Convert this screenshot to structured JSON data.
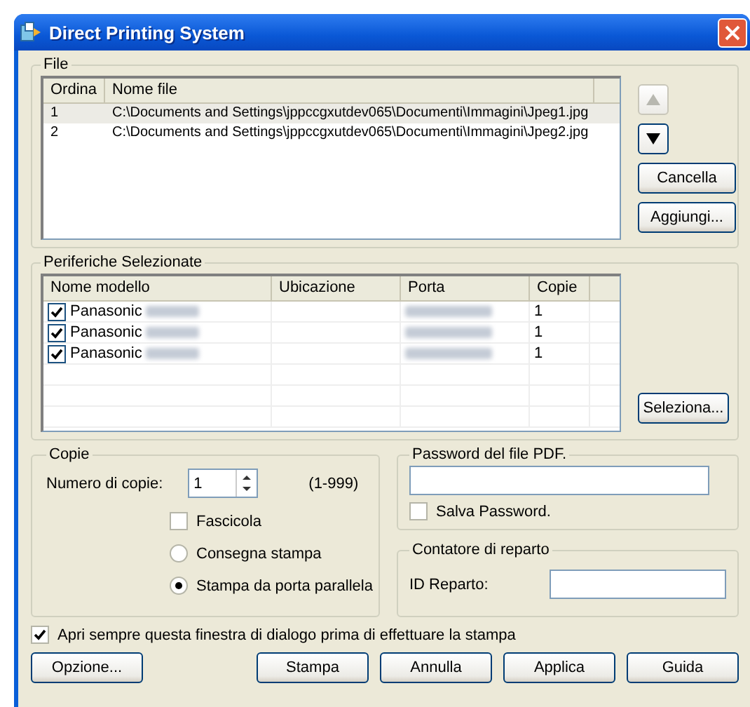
{
  "window": {
    "title": "Direct Printing System"
  },
  "file_group": {
    "label": "File",
    "columns": [
      "Ordina",
      "Nome file"
    ],
    "rows": [
      {
        "order": "1",
        "path": "C:\\Documents and Settings\\jppccgxutdev065\\Documenti\\Immagini\\Jpeg1.jpg",
        "selected": true
      },
      {
        "order": "2",
        "path": "C:\\Documents and Settings\\jppccgxutdev065\\Documenti\\Immagini\\Jpeg2.jpg",
        "selected": false
      }
    ],
    "move_up": {
      "disabled": true
    },
    "move_down": {
      "disabled": false
    },
    "buttons": [
      "Cancella",
      "Aggiungi..."
    ]
  },
  "devices": {
    "label": "Periferiche Selezionate",
    "columns": [
      "Nome modello",
      "Ubicazione",
      "Porta",
      "Copie"
    ],
    "rows": [
      {
        "name": "Panasonic",
        "checked": true,
        "copies": "1"
      },
      {
        "name": "Panasonic",
        "checked": true,
        "copies": "1"
      },
      {
        "name": "Panasonic",
        "checked": true,
        "copies": "1"
      }
    ],
    "button": "Seleziona..."
  },
  "copies": {
    "label": "Copie",
    "count_label": "Numero di copie:",
    "count": "1",
    "range": "(1-999)",
    "collate": {
      "label": "Fascicola",
      "checked": false
    },
    "options": [
      {
        "label": "Consegna stampa",
        "selected": false
      },
      {
        "label": "Stampa da porta parallela",
        "selected": true
      }
    ]
  },
  "pdf_password": {
    "label": "Password del file PDF.",
    "save": {
      "label": "Salva Password.",
      "checked": false
    }
  },
  "department": {
    "label": "Contatore di reparto",
    "id_label": "ID Reparto:"
  },
  "always_open": {
    "label": "Apri sempre questa finestra di dialogo prima di effettuare la stampa",
    "checked": true
  },
  "buttons": [
    "Opzione...",
    "Stampa",
    "Annulla",
    "Applica",
    "Guida"
  ]
}
